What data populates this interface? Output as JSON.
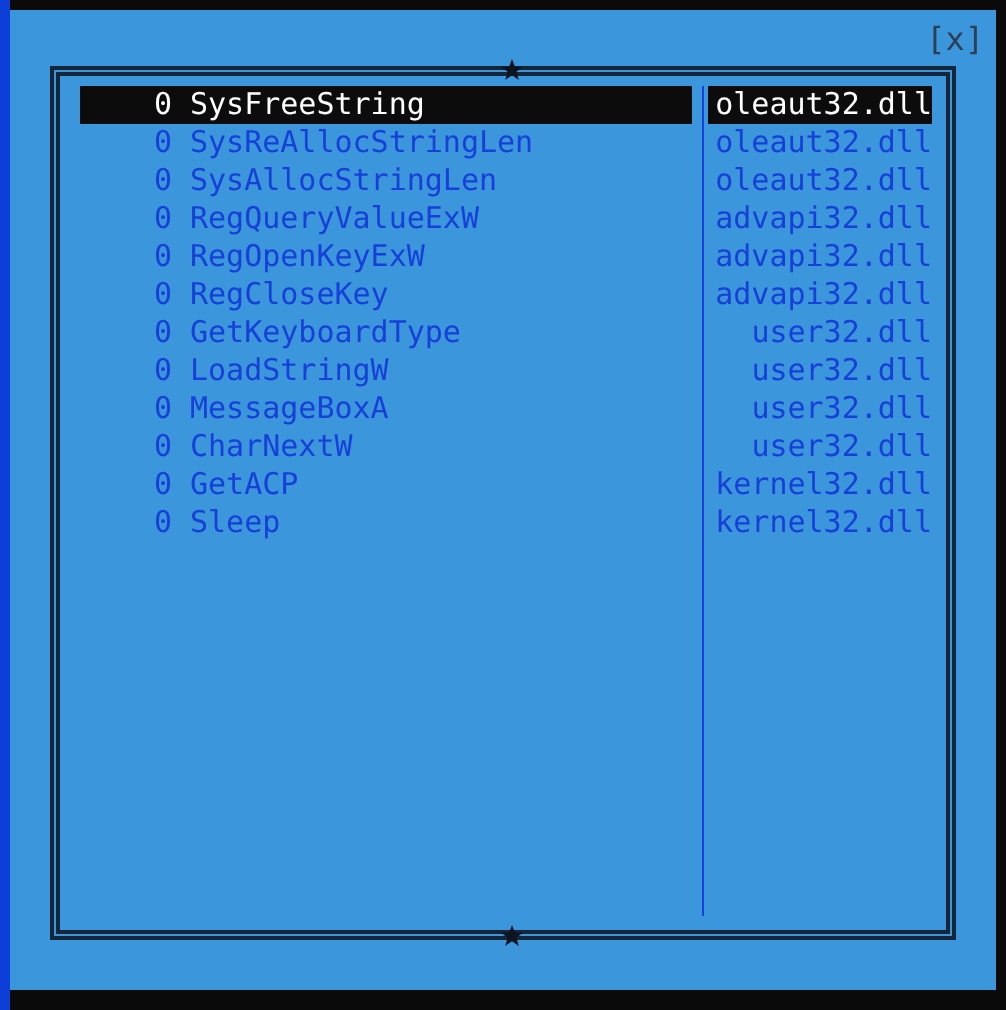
{
  "dialog": {
    "close_label": "[x]"
  },
  "rows": [
    {
      "count": "0",
      "name": "SysFreeString",
      "module": "oleaut32.dll",
      "selected": true
    },
    {
      "count": "0",
      "name": "SysReAllocStringLen",
      "module": "oleaut32.dll",
      "selected": false
    },
    {
      "count": "0",
      "name": "SysAllocStringLen",
      "module": "oleaut32.dll",
      "selected": false
    },
    {
      "count": "0",
      "name": "RegQueryValueExW",
      "module": "advapi32.dll",
      "selected": false
    },
    {
      "count": "0",
      "name": "RegOpenKeyExW",
      "module": "advapi32.dll",
      "selected": false
    },
    {
      "count": "0",
      "name": "RegCloseKey",
      "module": "advapi32.dll",
      "selected": false
    },
    {
      "count": "0",
      "name": "GetKeyboardType",
      "module": "user32.dll",
      "selected": false
    },
    {
      "count": "0",
      "name": "LoadStringW",
      "module": "user32.dll",
      "selected": false
    },
    {
      "count": "0",
      "name": "MessageBoxA",
      "module": "user32.dll",
      "selected": false
    },
    {
      "count": "0",
      "name": "CharNextW",
      "module": "user32.dll",
      "selected": false
    },
    {
      "count": "0",
      "name": "GetACP",
      "module": "kernel32.dll",
      "selected": false
    },
    {
      "count": "0",
      "name": "Sleep",
      "module": "kernel32.dll",
      "selected": false
    }
  ]
}
